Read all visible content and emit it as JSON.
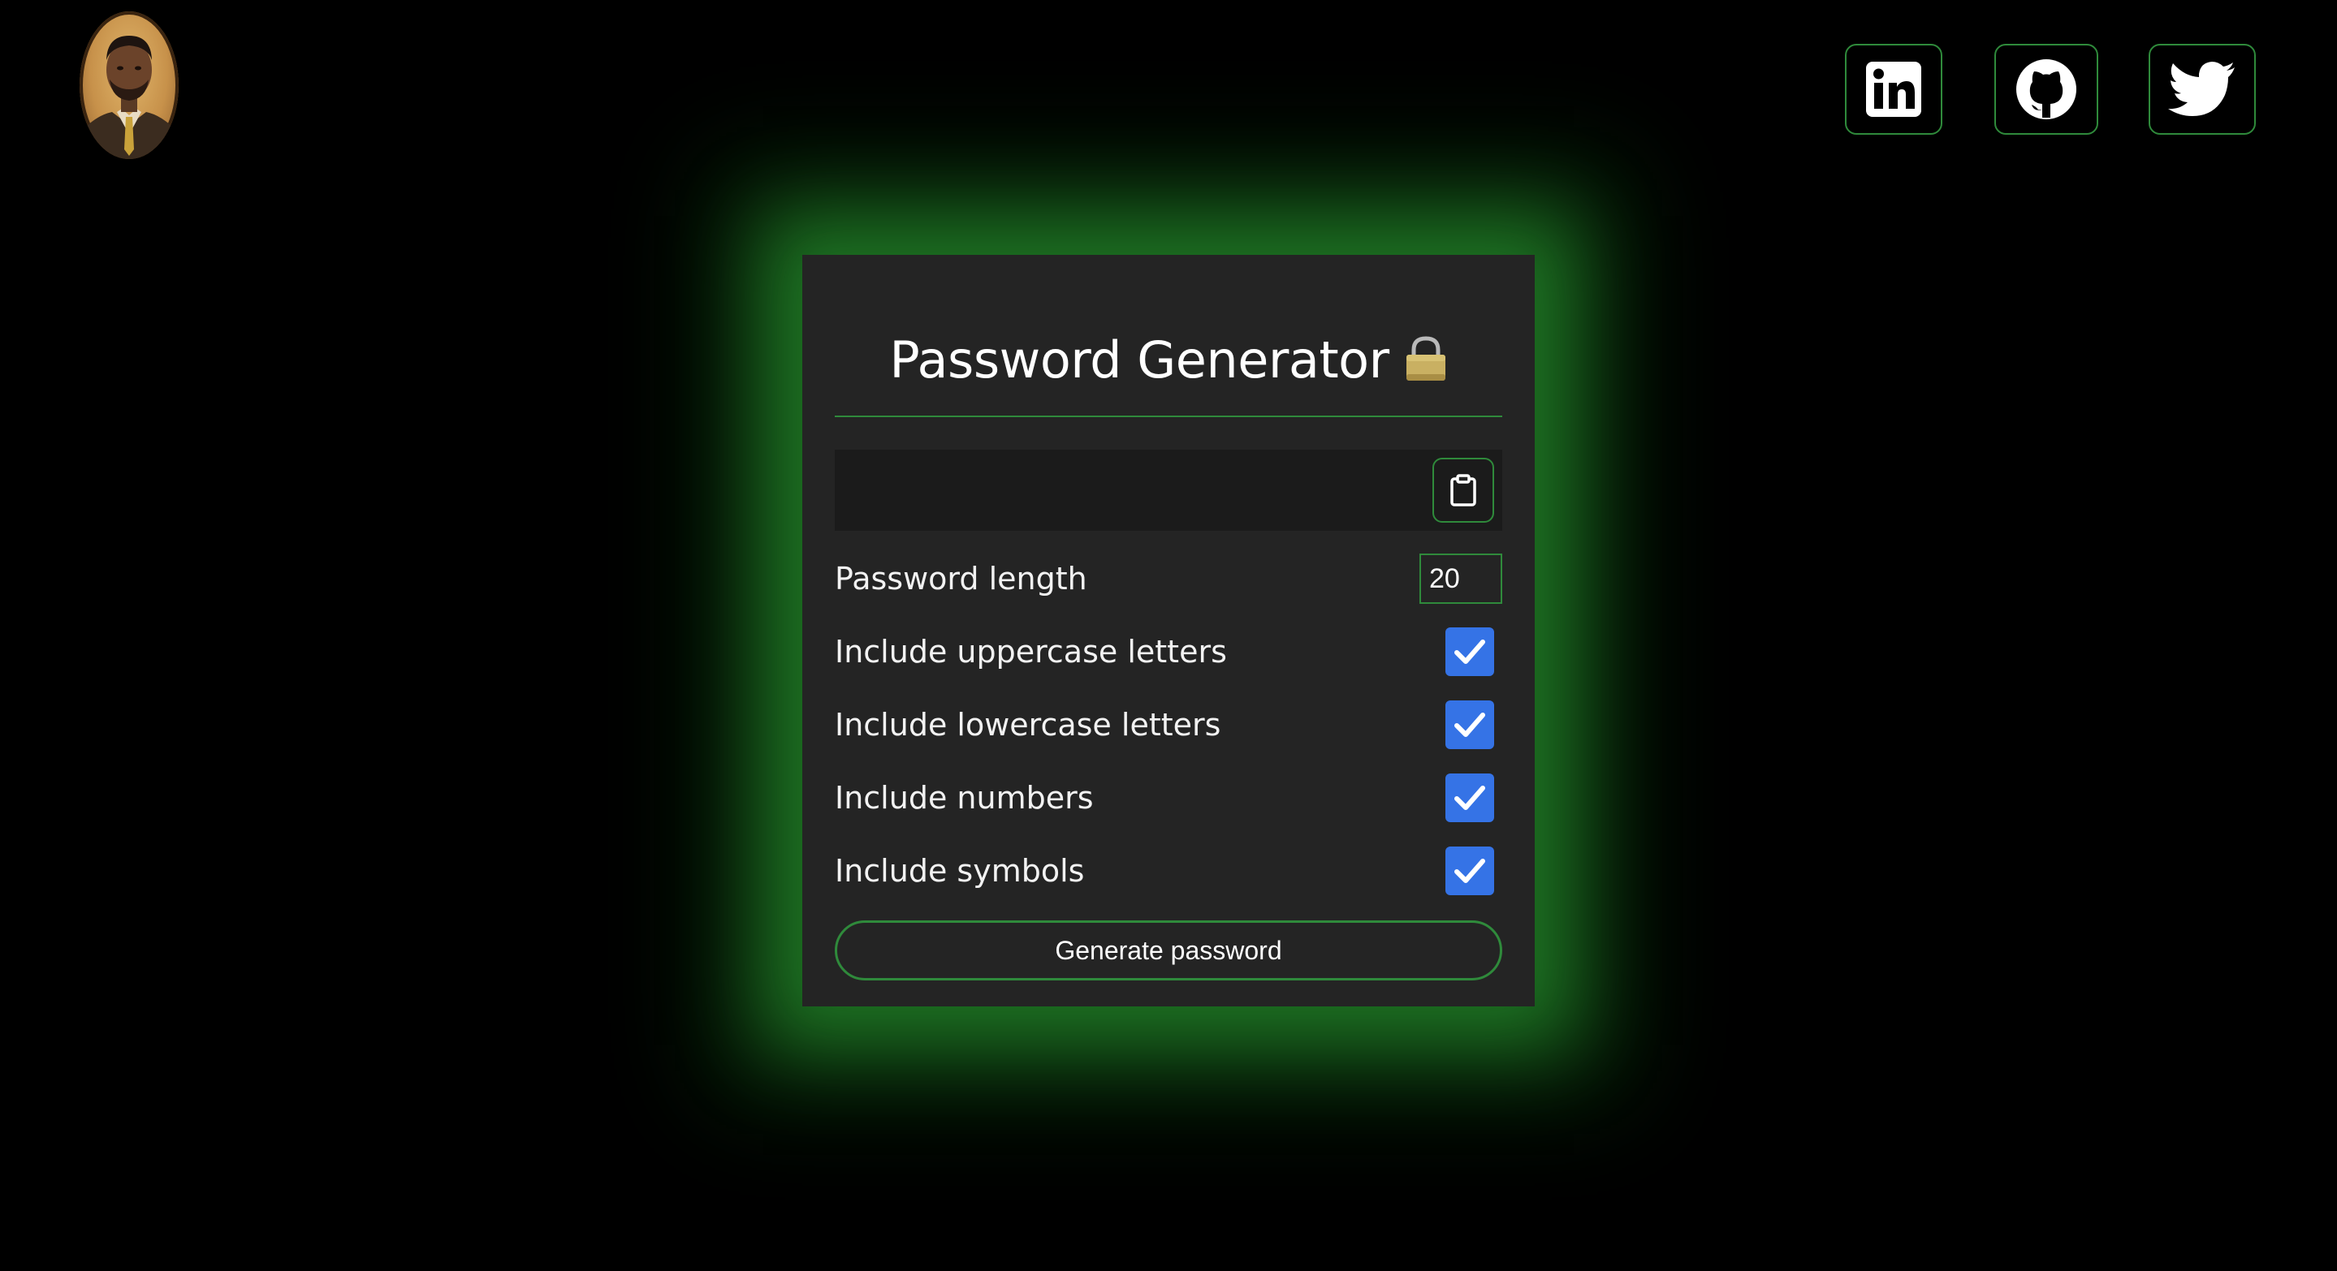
{
  "header": {
    "avatar_alt": "profile portrait",
    "social": [
      {
        "name": "linkedin-icon"
      },
      {
        "name": "github-icon"
      },
      {
        "name": "twitter-icon"
      }
    ]
  },
  "card": {
    "title": "Password Generator",
    "title_icon": "lock-icon",
    "password_value": "",
    "copy_icon": "clipboard-icon",
    "length_label": "Password length",
    "length_value": "20",
    "options": [
      {
        "label": "Include uppercase letters",
        "checked": true
      },
      {
        "label": "Include lowercase letters",
        "checked": true
      },
      {
        "label": "Include numbers",
        "checked": true
      },
      {
        "label": "Include symbols",
        "checked": true
      }
    ],
    "generate_label": "Generate password"
  },
  "colors": {
    "accent_green": "#2f8a3b",
    "glow_green": "#268c2c",
    "card_bg": "#242424",
    "checkbox_blue": "#3573e6",
    "page_bg": "#000000"
  }
}
